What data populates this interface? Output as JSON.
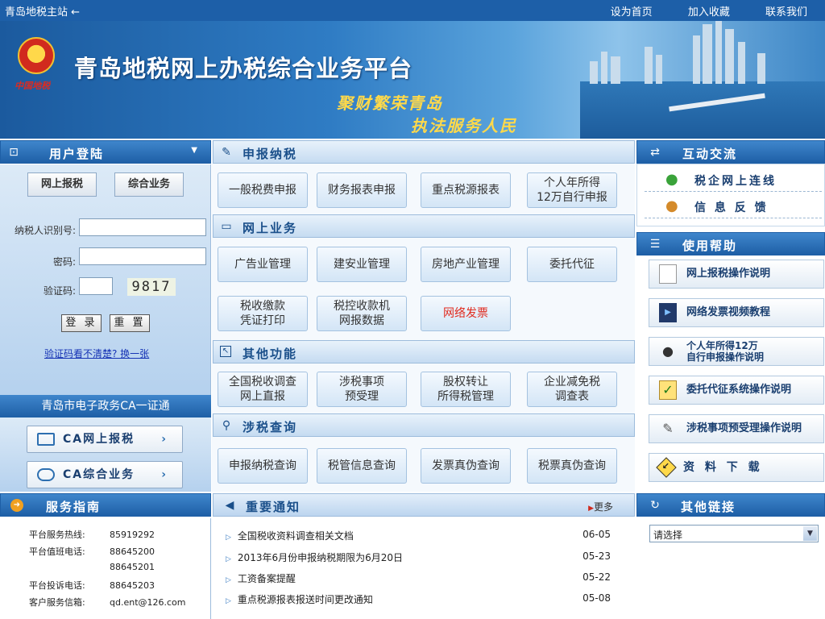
{
  "topbar": {
    "home": "青岛地税主站 ←",
    "set_home": "设为首页",
    "favorite": "加入收藏",
    "contact": "联系我们"
  },
  "banner": {
    "emblem_label": "中国地税",
    "title": "青岛地税网上办税综合业务平台",
    "slogan1": "聚财繁荣青岛",
    "slogan2": "执法服务人民"
  },
  "login": {
    "header": "用户登陆",
    "tab_online": "网上报税",
    "tab_general": "综合业务",
    "taxpayer_id_label": "纳税人识别号:",
    "password_label": "密码:",
    "captcha_label": "验证码:",
    "captcha_value": "9817",
    "login_button": "登 录",
    "reset_button": "重 置",
    "refresh_link": "验证码看不清楚? 换一张"
  },
  "ca": {
    "header": "青岛市电子政务CA一证通",
    "btn1": "CA网上报税",
    "btn2": "CA综合业务"
  },
  "sections": {
    "declare": {
      "title": "申报纳税",
      "buttons": [
        "一般税费申报",
        "财务报表申报",
        "重点税源报表",
        "个人年所得\n12万自行申报"
      ]
    },
    "online": {
      "title": "网上业务",
      "buttons": [
        "广告业管理",
        "建安业管理",
        "房地产业管理",
        "委托代征",
        "税收缴款\n凭证打印",
        "税控收款机\n网报数据",
        "网络发票"
      ]
    },
    "other": {
      "title": "其他功能",
      "buttons": [
        "全国税收调查\n网上直报",
        "涉税事项\n预受理",
        "股权转让\n所得税管理",
        "企业减免税\n调查表"
      ]
    },
    "query": {
      "title": "涉税查询",
      "buttons": [
        "申报纳税查询",
        "税管信息查询",
        "发票真伪查询",
        "税票真伪查询"
      ]
    }
  },
  "interact": {
    "header": "互动交流",
    "item1": "税企网上连线",
    "item2": "信 息 反 馈"
  },
  "help": {
    "header": "使用帮助",
    "items": [
      "网上报税操作说明",
      "网络发票视频教程",
      "个人年所得12万\n自行申报操作说明",
      "委托代征系统操作说明",
      "涉税事项预受理操作说明",
      "资 料 下 载"
    ]
  },
  "guide": {
    "header": "服务指南",
    "rows": [
      {
        "k": "平台服务热线:",
        "v": "85919292"
      },
      {
        "k": "平台值班电话:",
        "v": "88645200"
      },
      {
        "k": "",
        "v": "88645201"
      },
      {
        "k": "平台投诉电话:",
        "v": "88645203"
      },
      {
        "k": "客户服务信箱:",
        "v": "qd.ent@126.com"
      }
    ]
  },
  "notices": {
    "header": "重要通知",
    "more": "更多",
    "items": [
      {
        "title": "全国税收资料调查相关文档",
        "date": "06-05"
      },
      {
        "title": "2013年6月份申报纳税期限为6月20日",
        "date": "05-23"
      },
      {
        "title": "工资备案提醒",
        "date": "05-22"
      },
      {
        "title": "重点税源报表报送时间更改通知",
        "date": "05-08"
      }
    ]
  },
  "links": {
    "header": "其他链接",
    "select": "请选择"
  },
  "colors": {
    "primary": "#1e5fa6",
    "accent": "#ffd94a",
    "alert": "#e02a1e"
  }
}
